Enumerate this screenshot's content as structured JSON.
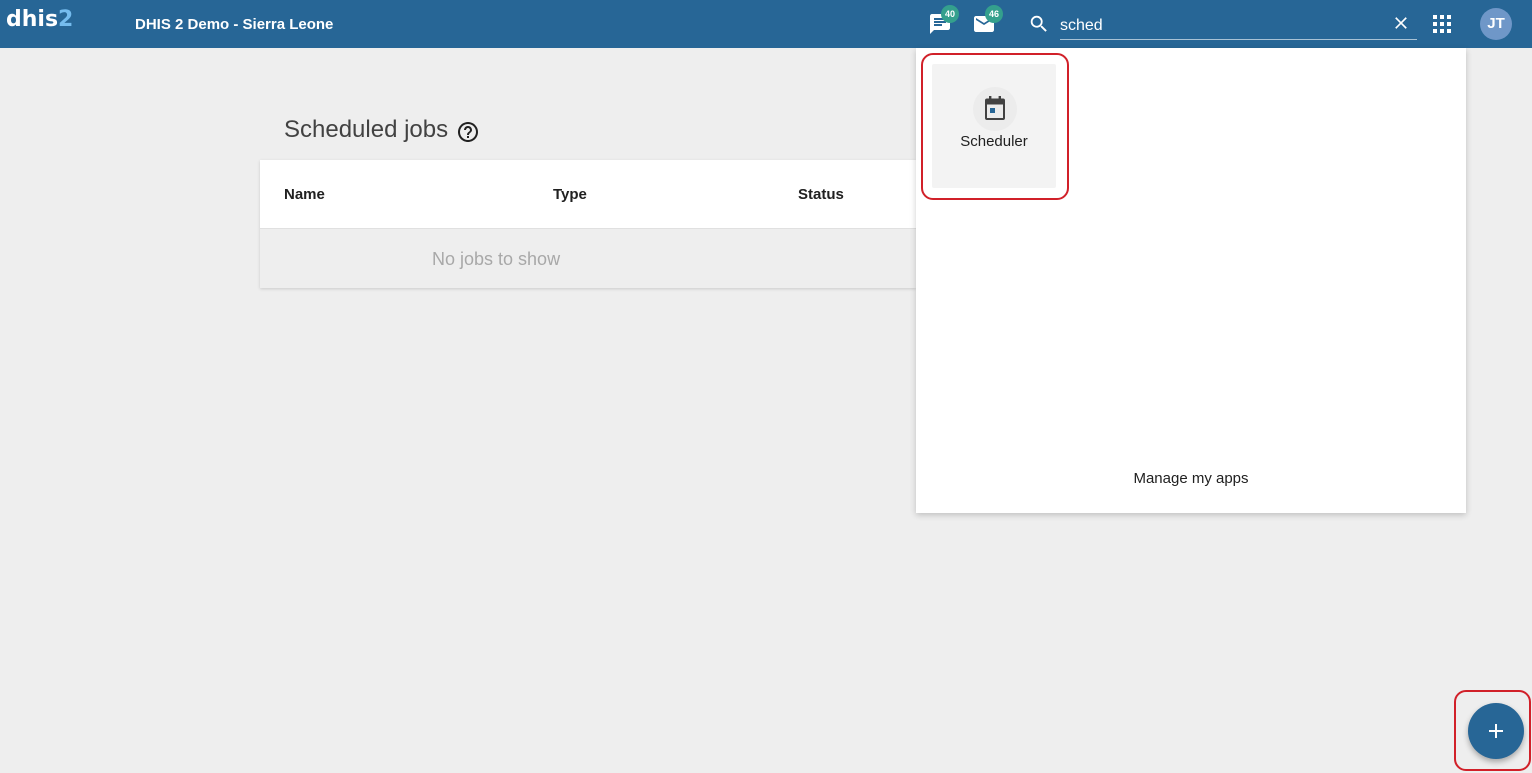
{
  "header": {
    "logo_text": "dhis",
    "logo_digit": "2",
    "instance_title": "DHIS 2 Demo - Sierra Leone",
    "interpretations_icon": "chat-bubble-icon",
    "interpretations_count": "40",
    "messages_icon": "envelope-icon",
    "messages_count": "46",
    "search_icon": "search-icon",
    "search_value": "sched",
    "clear_icon": "close-icon",
    "apps_icon": "apps-grid-icon",
    "user_initials": "JT"
  },
  "apps_menu": {
    "apps": [
      {
        "label": "Scheduler",
        "icon": "calendar-icon"
      }
    ],
    "manage_label": "Manage my apps"
  },
  "main": {
    "title": "Scheduled jobs",
    "help_icon": "help-circle-icon",
    "columns": [
      "Name",
      "Type",
      "Status"
    ],
    "empty_message": "No jobs to show"
  },
  "fab": {
    "icon": "plus-icon"
  },
  "colors": {
    "header_bg": "#276696",
    "badge": "#34a08d",
    "highlight": "#d12029",
    "background": "#eeeeee"
  }
}
